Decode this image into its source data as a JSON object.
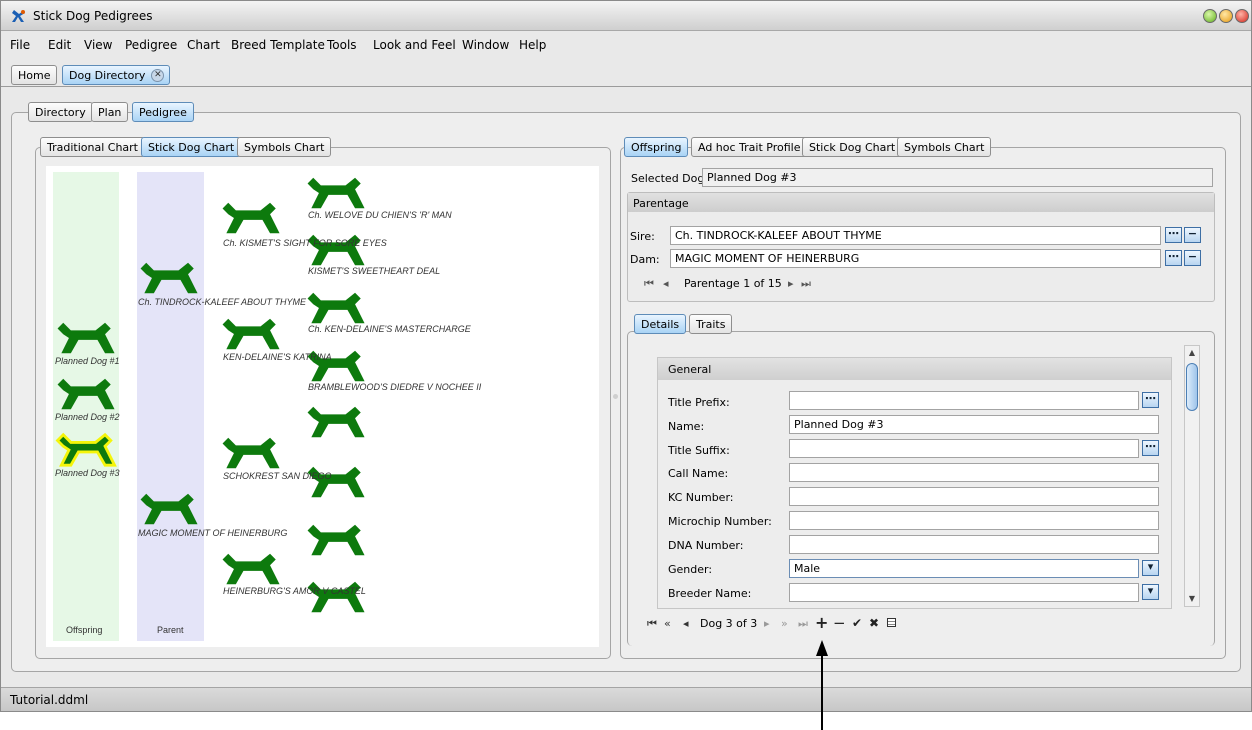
{
  "window": {
    "title": "Stick Dog Pedigrees"
  },
  "menu": [
    "File",
    "Edit",
    "View",
    "Pedigree",
    "Chart",
    "Breed Template",
    "Tools",
    "Look and Feel",
    "Window",
    "Help"
  ],
  "doc_tabs": {
    "home": "Home",
    "dog_directory": "Dog Directory"
  },
  "sub_tabs": {
    "directory": "Directory",
    "plan": "Plan",
    "pedigree": "Pedigree"
  },
  "left_tabs": {
    "traditional": "Traditional Chart",
    "stickdog": "Stick Dog Chart",
    "symbols": "Symbols Chart"
  },
  "chart": {
    "col_offspring": "Offspring",
    "col_parent": "Parent",
    "offspring": [
      "Planned Dog #1",
      "Planned Dog #2",
      "Planned Dog #3"
    ],
    "parents": [
      "Ch. TINDROCK-KALEEF ABOUT THYME",
      "MAGIC MOMENT OF HEINERBURG"
    ],
    "grandparents": [
      "Ch. KISMET'S SIGHT FOR SORE EYES",
      "KEN-DELAINE'S KATRINA",
      "SCHOKREST SAN DIEGO",
      "HEINERBURG'S AMOR V CASTEL"
    ],
    "greatgrandparents": [
      "Ch. WELOVE DU CHIEN'S 'R' MAN",
      "KISMET'S SWEETHEART DEAL",
      "Ch. KEN-DELAINE'S MASTERCHARGE",
      "BRAMBLEWOOD'S DIEDRE V NOCHEE II"
    ]
  },
  "right_tabs": {
    "offspring": "Offspring",
    "adhoc": "Ad hoc Trait Profile",
    "stickdog": "Stick Dog Chart",
    "symbols": "Symbols Chart"
  },
  "selected_dog": {
    "label": "Selected Dog:",
    "value": "Planned Dog #3"
  },
  "parentage": {
    "title": "Parentage",
    "sire_label": "Sire:",
    "sire": "Ch. TINDROCK-KALEEF ABOUT THYME",
    "dam_label": "Dam:",
    "dam": "MAGIC MOMENT OF HEINERBURG",
    "nav": "Parentage 1 of 15"
  },
  "detail_tabs": {
    "details": "Details",
    "traits": "Traits"
  },
  "general": {
    "title": "General",
    "title_prefix_label": "Title Prefix:",
    "title_prefix": "",
    "name_label": "Name:",
    "name": "Planned Dog #3",
    "title_suffix_label": "Title Suffix:",
    "title_suffix": "",
    "call_name_label": "Call Name:",
    "call_name": "",
    "kc_label": "KC Number:",
    "kc": "",
    "microchip_label": "Microchip Number:",
    "microchip": "",
    "dna_label": "DNA Number:",
    "dna": "",
    "gender_label": "Gender:",
    "gender": "Male",
    "breeder_label": "Breeder Name:",
    "breeder": ""
  },
  "record_nav": {
    "text": "Dog 3 of 3"
  },
  "status": {
    "file": "Tutorial.ddml"
  },
  "colors": {
    "dog": "#0d7a0d",
    "highlight": "#f5f50a",
    "accent": "#a9d3f5",
    "offspring_col": "#e6f8e6",
    "parent_col": "#e4e4f8"
  }
}
